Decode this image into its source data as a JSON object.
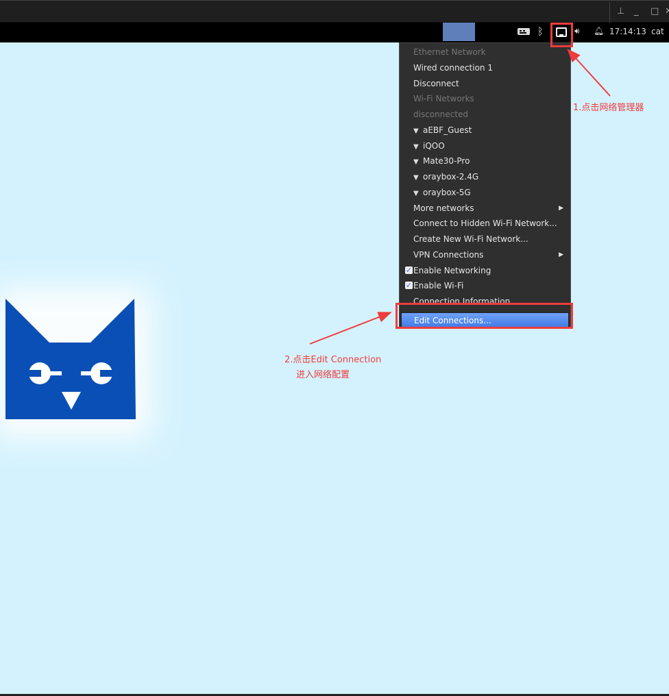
{
  "window": {
    "controls": [
      "pin",
      "minimize",
      "maximize",
      "close"
    ]
  },
  "panel": {
    "clock": "17:14:13",
    "user": "cat",
    "tray_icons": [
      "keyboard-icon",
      "bluetooth-icon",
      "network-icon",
      "volume-icon",
      "bell-icon"
    ]
  },
  "menu": {
    "items": [
      {
        "label": "Ethernet Network",
        "disabled": true
      },
      {
        "label": "Wired connection 1"
      },
      {
        "label": "Disconnect"
      },
      {
        "label": "Wi-Fi Networks",
        "disabled": true
      },
      {
        "label": "disconnected",
        "disabled": true
      },
      {
        "label": "aEBF_Guest",
        "wifi": true
      },
      {
        "label": "iQOO",
        "wifi": true
      },
      {
        "label": "Mate30-Pro",
        "wifi": true
      },
      {
        "label": "oraybox-2.4G",
        "wifi": true
      },
      {
        "label": "oraybox-5G",
        "wifi": true
      },
      {
        "label": "More networks",
        "submenu": true
      },
      {
        "label": "Connect to Hidden Wi-Fi Network..."
      },
      {
        "label": "Create New Wi-Fi Network..."
      },
      {
        "label": "VPN Connections",
        "submenu": true
      },
      {
        "label": "Enable Networking",
        "checked": true
      },
      {
        "label": "Enable Wi-Fi",
        "checked": true
      },
      {
        "label": "Connection Information"
      },
      {
        "label": "Edit Connections...",
        "selected": true
      }
    ]
  },
  "annotations": {
    "step1": "1.点击网络管理器",
    "step2_line1": "2.点击Edit Connection",
    "step2_line2": "进入网络配置"
  },
  "colors": {
    "annotation": "#f03c3c",
    "logo": "#0a4fb5",
    "desktop": "#d4f2fd"
  }
}
